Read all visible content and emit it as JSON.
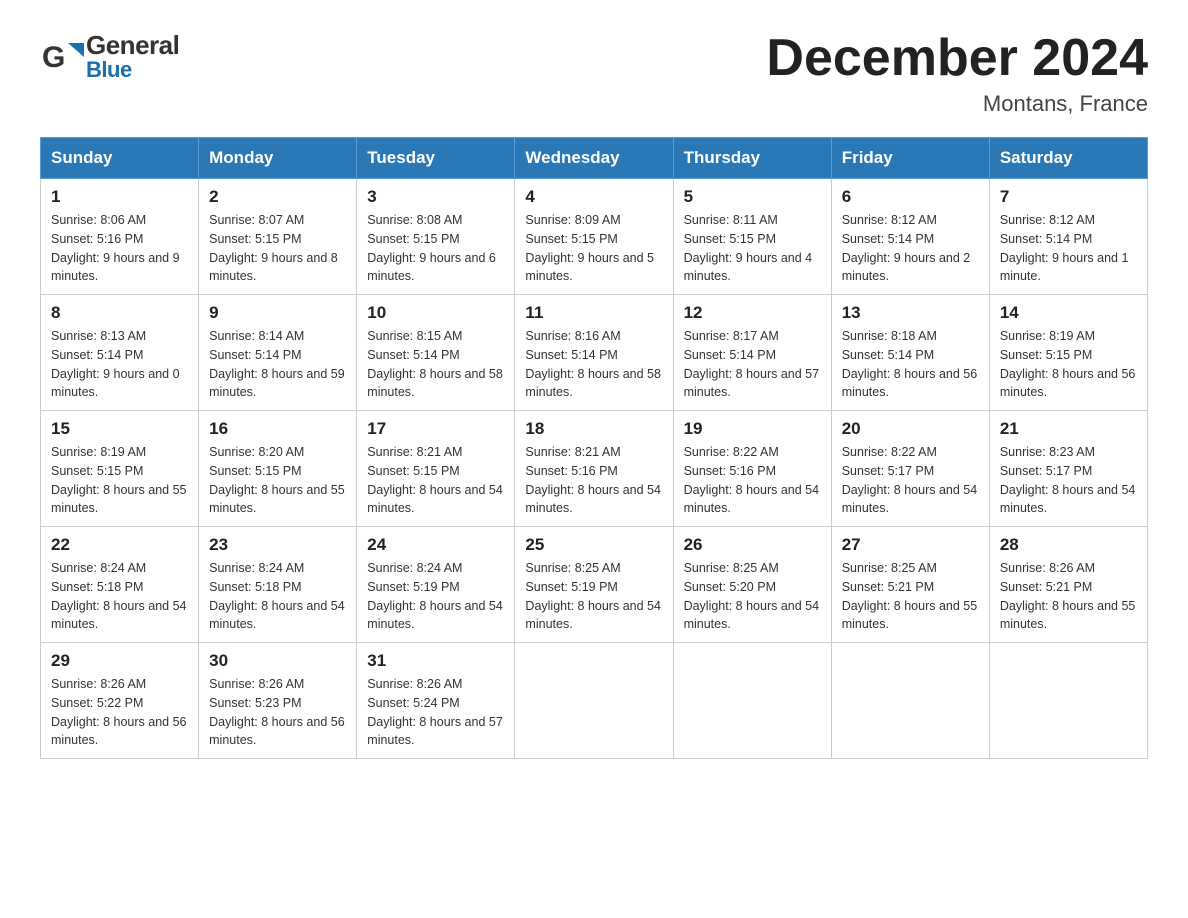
{
  "header": {
    "logo_general": "General",
    "logo_blue": "Blue",
    "month_title": "December 2024",
    "location": "Montans, France"
  },
  "days_of_week": [
    "Sunday",
    "Monday",
    "Tuesday",
    "Wednesday",
    "Thursday",
    "Friday",
    "Saturday"
  ],
  "weeks": [
    [
      {
        "day": "1",
        "sunrise": "8:06 AM",
        "sunset": "5:16 PM",
        "daylight": "9 hours and 9 minutes."
      },
      {
        "day": "2",
        "sunrise": "8:07 AM",
        "sunset": "5:15 PM",
        "daylight": "9 hours and 8 minutes."
      },
      {
        "day": "3",
        "sunrise": "8:08 AM",
        "sunset": "5:15 PM",
        "daylight": "9 hours and 6 minutes."
      },
      {
        "day": "4",
        "sunrise": "8:09 AM",
        "sunset": "5:15 PM",
        "daylight": "9 hours and 5 minutes."
      },
      {
        "day": "5",
        "sunrise": "8:11 AM",
        "sunset": "5:15 PM",
        "daylight": "9 hours and 4 minutes."
      },
      {
        "day": "6",
        "sunrise": "8:12 AM",
        "sunset": "5:14 PM",
        "daylight": "9 hours and 2 minutes."
      },
      {
        "day": "7",
        "sunrise": "8:12 AM",
        "sunset": "5:14 PM",
        "daylight": "9 hours and 1 minute."
      }
    ],
    [
      {
        "day": "8",
        "sunrise": "8:13 AM",
        "sunset": "5:14 PM",
        "daylight": "9 hours and 0 minutes."
      },
      {
        "day": "9",
        "sunrise": "8:14 AM",
        "sunset": "5:14 PM",
        "daylight": "8 hours and 59 minutes."
      },
      {
        "day": "10",
        "sunrise": "8:15 AM",
        "sunset": "5:14 PM",
        "daylight": "8 hours and 58 minutes."
      },
      {
        "day": "11",
        "sunrise": "8:16 AM",
        "sunset": "5:14 PM",
        "daylight": "8 hours and 58 minutes."
      },
      {
        "day": "12",
        "sunrise": "8:17 AM",
        "sunset": "5:14 PM",
        "daylight": "8 hours and 57 minutes."
      },
      {
        "day": "13",
        "sunrise": "8:18 AM",
        "sunset": "5:14 PM",
        "daylight": "8 hours and 56 minutes."
      },
      {
        "day": "14",
        "sunrise": "8:19 AM",
        "sunset": "5:15 PM",
        "daylight": "8 hours and 56 minutes."
      }
    ],
    [
      {
        "day": "15",
        "sunrise": "8:19 AM",
        "sunset": "5:15 PM",
        "daylight": "8 hours and 55 minutes."
      },
      {
        "day": "16",
        "sunrise": "8:20 AM",
        "sunset": "5:15 PM",
        "daylight": "8 hours and 55 minutes."
      },
      {
        "day": "17",
        "sunrise": "8:21 AM",
        "sunset": "5:15 PM",
        "daylight": "8 hours and 54 minutes."
      },
      {
        "day": "18",
        "sunrise": "8:21 AM",
        "sunset": "5:16 PM",
        "daylight": "8 hours and 54 minutes."
      },
      {
        "day": "19",
        "sunrise": "8:22 AM",
        "sunset": "5:16 PM",
        "daylight": "8 hours and 54 minutes."
      },
      {
        "day": "20",
        "sunrise": "8:22 AM",
        "sunset": "5:17 PM",
        "daylight": "8 hours and 54 minutes."
      },
      {
        "day": "21",
        "sunrise": "8:23 AM",
        "sunset": "5:17 PM",
        "daylight": "8 hours and 54 minutes."
      }
    ],
    [
      {
        "day": "22",
        "sunrise": "8:24 AM",
        "sunset": "5:18 PM",
        "daylight": "8 hours and 54 minutes."
      },
      {
        "day": "23",
        "sunrise": "8:24 AM",
        "sunset": "5:18 PM",
        "daylight": "8 hours and 54 minutes."
      },
      {
        "day": "24",
        "sunrise": "8:24 AM",
        "sunset": "5:19 PM",
        "daylight": "8 hours and 54 minutes."
      },
      {
        "day": "25",
        "sunrise": "8:25 AM",
        "sunset": "5:19 PM",
        "daylight": "8 hours and 54 minutes."
      },
      {
        "day": "26",
        "sunrise": "8:25 AM",
        "sunset": "5:20 PM",
        "daylight": "8 hours and 54 minutes."
      },
      {
        "day": "27",
        "sunrise": "8:25 AM",
        "sunset": "5:21 PM",
        "daylight": "8 hours and 55 minutes."
      },
      {
        "day": "28",
        "sunrise": "8:26 AM",
        "sunset": "5:21 PM",
        "daylight": "8 hours and 55 minutes."
      }
    ],
    [
      {
        "day": "29",
        "sunrise": "8:26 AM",
        "sunset": "5:22 PM",
        "daylight": "8 hours and 56 minutes."
      },
      {
        "day": "30",
        "sunrise": "8:26 AM",
        "sunset": "5:23 PM",
        "daylight": "8 hours and 56 minutes."
      },
      {
        "day": "31",
        "sunrise": "8:26 AM",
        "sunset": "5:24 PM",
        "daylight": "8 hours and 57 minutes."
      },
      null,
      null,
      null,
      null
    ]
  ],
  "labels": {
    "sunrise": "Sunrise:",
    "sunset": "Sunset:",
    "daylight": "Daylight:"
  }
}
